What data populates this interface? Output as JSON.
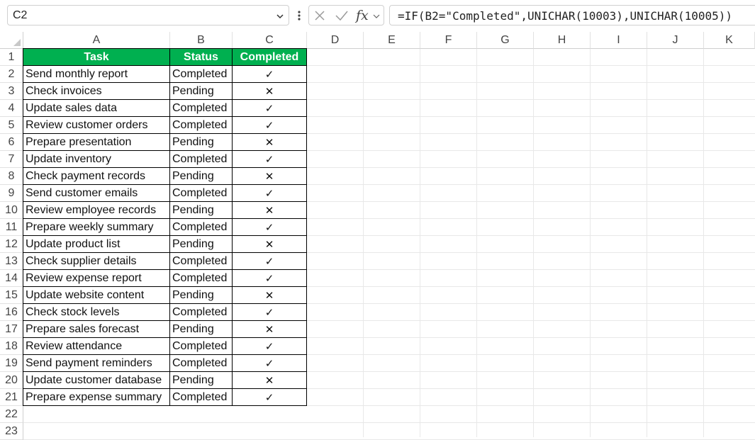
{
  "formula_bar": {
    "name_box": "C2",
    "formula": "=IF(B2=\"Completed\",UNICHAR(10003),UNICHAR(10005))",
    "fx_label": "fx"
  },
  "columns": [
    "A",
    "B",
    "C",
    "D",
    "E",
    "F",
    "G",
    "H",
    "I",
    "J",
    "K"
  ],
  "rows": [
    "1",
    "2",
    "3",
    "4",
    "5",
    "6",
    "7",
    "8",
    "9",
    "10",
    "11",
    "12",
    "13",
    "14",
    "15",
    "16",
    "17",
    "18",
    "19",
    "20",
    "21",
    "22",
    "23"
  ],
  "table": {
    "headers": [
      "Task",
      "Status",
      "Completed"
    ],
    "header_color": "#00b050",
    "rows": [
      {
        "task": "Send monthly report",
        "status": "Completed",
        "mark": "✓"
      },
      {
        "task": "Check invoices",
        "status": "Pending",
        "mark": "✕"
      },
      {
        "task": "Update sales data",
        "status": "Completed",
        "mark": "✓"
      },
      {
        "task": "Review customer orders",
        "status": "Completed",
        "mark": "✓"
      },
      {
        "task": "Prepare presentation",
        "status": "Pending",
        "mark": "✕"
      },
      {
        "task": "Update inventory",
        "status": "Completed",
        "mark": "✓"
      },
      {
        "task": "Check payment records",
        "status": "Pending",
        "mark": "✕"
      },
      {
        "task": "Send customer emails",
        "status": "Completed",
        "mark": "✓"
      },
      {
        "task": "Review employee records",
        "status": "Pending",
        "mark": "✕"
      },
      {
        "task": "Prepare weekly summary",
        "status": "Completed",
        "mark": "✓"
      },
      {
        "task": "Update product list",
        "status": "Pending",
        "mark": "✕"
      },
      {
        "task": "Check supplier details",
        "status": "Completed",
        "mark": "✓"
      },
      {
        "task": "Review expense report",
        "status": "Completed",
        "mark": "✓"
      },
      {
        "task": "Update website content",
        "status": "Pending",
        "mark": "✕"
      },
      {
        "task": "Check stock levels",
        "status": "Completed",
        "mark": "✓"
      },
      {
        "task": "Prepare sales forecast",
        "status": "Pending",
        "mark": "✕"
      },
      {
        "task": "Review attendance",
        "status": "Completed",
        "mark": "✓"
      },
      {
        "task": "Send payment reminders",
        "status": "Completed",
        "mark": "✓"
      },
      {
        "task": "Update customer database",
        "status": "Pending",
        "mark": "✕"
      },
      {
        "task": "Prepare expense summary",
        "status": "Completed",
        "mark": "✓"
      }
    ]
  }
}
